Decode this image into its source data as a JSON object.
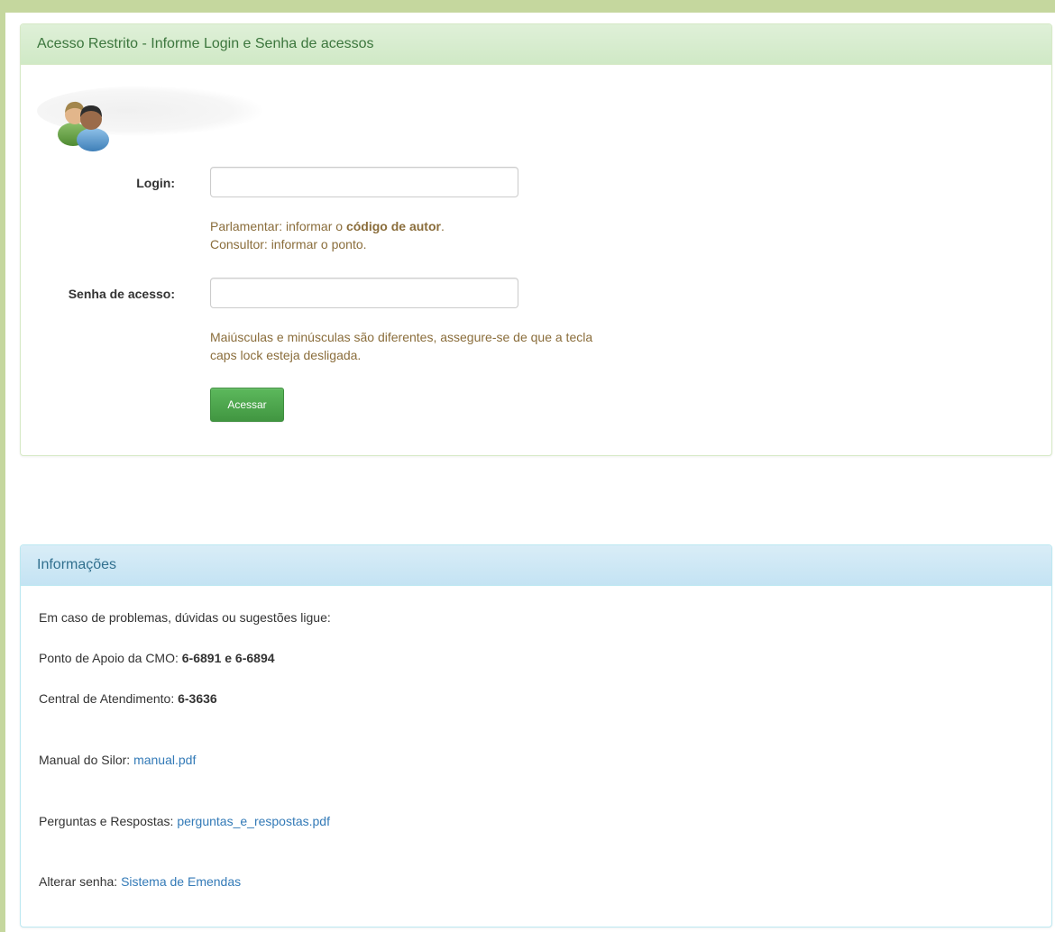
{
  "login_panel": {
    "title": "Acesso Restrito - Informe Login e Senha de acessos",
    "login_label": "Login:",
    "login_value": "",
    "login_help_line1_prefix": "Parlamentar: informar o ",
    "login_help_line1_bold": "código de autor",
    "login_help_line1_suffix": ".",
    "login_help_line2": "Consultor: informar o ponto.",
    "password_label": "Senha de acesso:",
    "password_value": "",
    "password_help_line1": "Maiúsculas e minúsculas são diferentes, assegure-se de que a tecla",
    "password_help_line2": "caps lock esteja desligada.",
    "submit_label": "Acessar",
    "icon": "users-icon"
  },
  "info_panel": {
    "title": "Informações",
    "intro": "Em caso de problemas, dúvidas ou sugestões ligue:",
    "support_label": "Ponto de Apoio da CMO: ",
    "support_numbers": "6-6891 e 6-6894",
    "central_label": "Central de Atendimento: ",
    "central_number": "6-3636",
    "manual_label": "Manual do Silor: ",
    "manual_link": "manual.pdf",
    "faq_label": "Perguntas e Respostas: ",
    "faq_link": "perguntas_e_respostas.pdf",
    "password_change_label": "Alterar senha: ",
    "password_change_link": "Sistema de Emendas"
  },
  "colors": {
    "background": "#c5d79e",
    "success_heading": "#dff0d8",
    "info_heading": "#d9edf7",
    "button": "#5cb85c",
    "link": "#337ab7",
    "help_text": "#8a6d3b"
  }
}
